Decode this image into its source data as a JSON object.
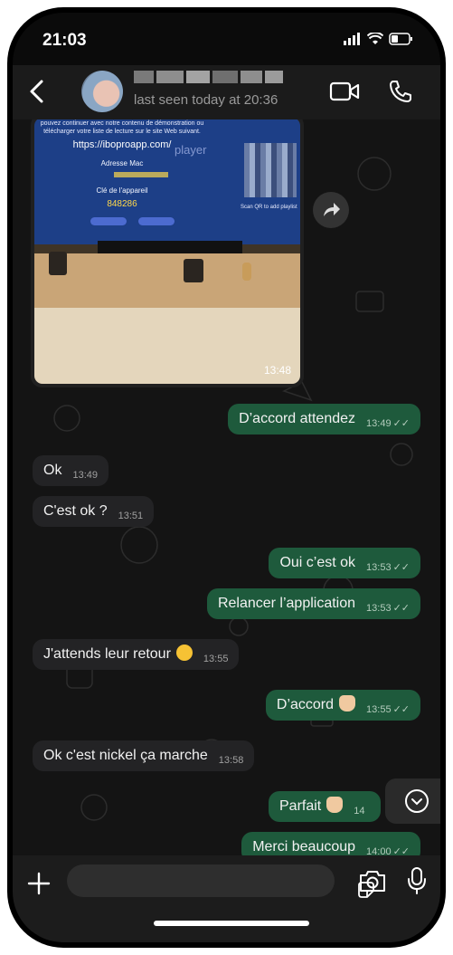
{
  "status_bar": {
    "time": "21:03"
  },
  "header": {
    "last_seen": "last seen today at 20:36"
  },
  "photo": {
    "time": "13:48",
    "tv_text_line1": "pouvez continuer avec notre contenu de démonstration ou",
    "tv_text_line2": "télécharger votre liste de lecture sur le site Web suivant.",
    "tv_url": "https://iboproapp.com/",
    "tv_brand": "player",
    "tv_mac_label": "Adresse Mac",
    "tv_key_label": "Clé de l'appareil",
    "tv_code": "848286",
    "tv_qr_caption": "Scan QR to add playlist"
  },
  "messages": [
    {
      "side": "out",
      "text": "D’accord attendez",
      "time": "13:49"
    },
    {
      "side": "in",
      "text": "Ok",
      "time": "13:49"
    },
    {
      "side": "in",
      "text": "C'est ok ?",
      "time": "13:51"
    },
    {
      "side": "out",
      "text": "Oui c’est ok",
      "time": "13:53"
    },
    {
      "side": "out",
      "text": "Relancer l’application",
      "time": "13:53"
    },
    {
      "side": "in",
      "text": "J'attends leur retour",
      "time": "13:55",
      "emoji": "winking-face"
    },
    {
      "side": "out",
      "text": "D’accord",
      "time": "13:55",
      "emoji": "thumbs-up"
    },
    {
      "side": "in",
      "text": "Ok c'est nickel ça marche",
      "time": "13:58"
    },
    {
      "side": "out",
      "text": "Parfait",
      "time": "14",
      "emoji": "thumbs-up"
    },
    {
      "side": "out",
      "text": "Merci beaucoup",
      "time": "14:00"
    }
  ],
  "colors": {
    "incoming_bubble": "#232325",
    "outgoing_bubble": "#1e5a3c",
    "background": "#141414"
  }
}
